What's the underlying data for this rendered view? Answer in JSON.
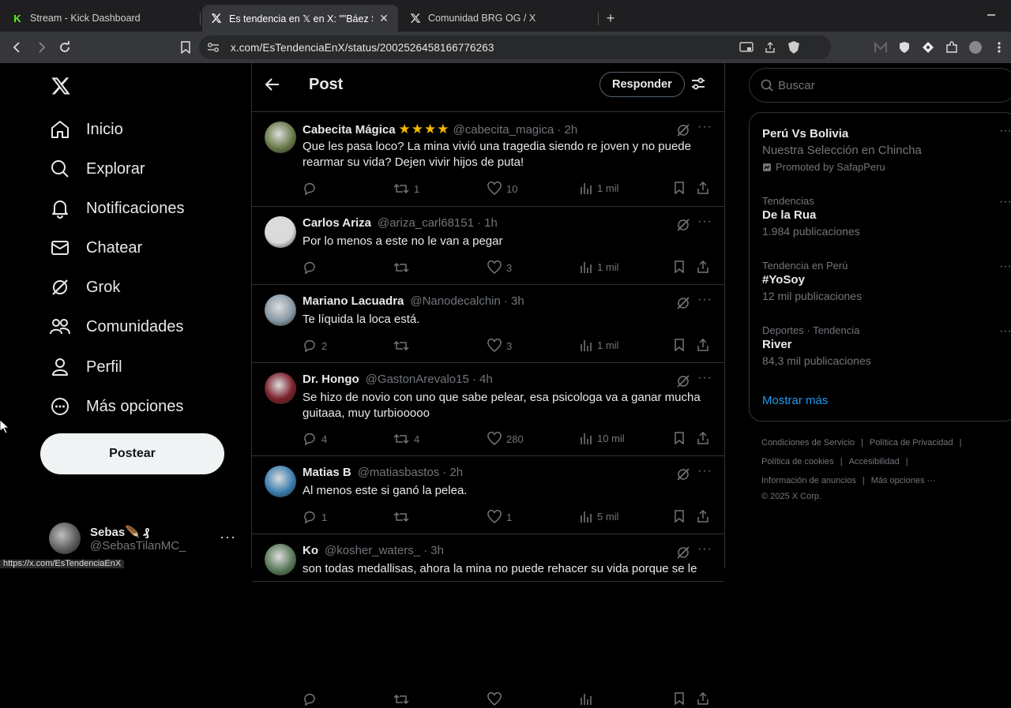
{
  "browser": {
    "tabs": [
      {
        "title": "Stream - Kick Dashboard",
        "favicon": "kick-icon",
        "active": false
      },
      {
        "title": "Es tendencia en 𝕏 en X: \"\"Báez Sosa",
        "favicon": "x-icon",
        "active": true
      },
      {
        "title": "Comunidad BRG OG / X",
        "favicon": "x-icon",
        "active": false
      }
    ],
    "url": "x.com/EsTendenciaEnX/status/2002526458166776263",
    "status_url": "https://x.com/EsTendenciaEnX"
  },
  "nav": {
    "items": [
      {
        "label": "Inicio",
        "icon": "home-icon"
      },
      {
        "label": "Explorar",
        "icon": "search-icon"
      },
      {
        "label": "Notificaciones",
        "icon": "bell-icon"
      },
      {
        "label": "Chatear",
        "icon": "mail-icon"
      },
      {
        "label": "Grok",
        "icon": "grok-icon"
      },
      {
        "label": "Comunidades",
        "icon": "communities-icon"
      },
      {
        "label": "Perfil",
        "icon": "person-icon"
      },
      {
        "label": "Más opciones",
        "icon": "more-circle-icon"
      }
    ],
    "post_button": "Postear",
    "account": {
      "name": "Sebas🪶 ₰",
      "handle": "@SebasTilanMC_"
    }
  },
  "main": {
    "title": "Post",
    "reply_button": "Responder",
    "posts": [
      {
        "name": "Cabecita Mágica",
        "stars": "★★★★",
        "handle": "@cabecita_magica",
        "time": "· 2h",
        "text": "Que les pasa loco? La mina vivió una tragedia siendo re joven y no puede rearmar su vida? Dejen vivir hijos de puta!",
        "replies": "",
        "reposts": "1",
        "likes": "10",
        "views": "1 mil",
        "avatar_color": "#6b7a4a"
      },
      {
        "name": "Carlos Ariza",
        "stars": "",
        "handle": "@ariza_carl68151",
        "time": "· 1h",
        "text": "Por lo menos a este no le van a pegar",
        "replies": "",
        "reposts": "",
        "likes": "3",
        "views": "1 mil",
        "avatar_color": "#d9d9d9"
      },
      {
        "name": "Mariano Lacuadra",
        "stars": "",
        "handle": "@Nanodecalchin",
        "time": "· 3h",
        "text": "Te líquida la loca está.",
        "replies": "2",
        "reposts": "",
        "likes": "3",
        "views": "1 mil",
        "avatar_color": "#8899a6"
      },
      {
        "name": "Dr. Hongo",
        "stars": "",
        "handle": "@GastonArevalo15",
        "time": "· 4h",
        "text": "Se hizo de novio con uno que sabe pelear, esa psicologa va a ganar mucha guitaaa, muy turbiooooo",
        "replies": "4",
        "reposts": "4",
        "likes": "280",
        "views": "10 mil",
        "avatar_color": "#7a1f2a"
      },
      {
        "name": "Matias B",
        "stars": "",
        "handle": "@matiasbastos",
        "time": "· 2h",
        "text": "Al menos este si ganó la pelea.",
        "replies": "1",
        "reposts": "",
        "likes": "1",
        "views": "5 mil",
        "avatar_color": "#3c7fb0"
      },
      {
        "name": "Ko",
        "stars": "",
        "handle": "@kosher_waters_",
        "time": "· 3h",
        "text": "son todas medallisas, ahora la mina no puede rehacer su vida porque se le",
        "replies": "",
        "reposts": "",
        "likes": "",
        "views": "",
        "avatar_color": "#5a7a5a"
      }
    ]
  },
  "sidebar": {
    "search_placeholder": "Buscar",
    "trends": [
      {
        "context": "",
        "name": "Perú Vs Bolivia",
        "subtitle": "Nuestra Selección en Chincha",
        "promoted": "Promoted by SafapPeru"
      },
      {
        "context": "Tendencias",
        "name": "De la Rua",
        "subtitle": "1.984 publicaciones",
        "promoted": ""
      },
      {
        "context": "Tendencia en Perú",
        "name": "#YoSoy",
        "subtitle": "12 mil publicaciones",
        "promoted": ""
      },
      {
        "context": "Deportes · Tendencia",
        "name": "River",
        "subtitle": "84,3 mil publicaciones",
        "promoted": ""
      }
    ],
    "show_more": "Mostrar más",
    "footer": {
      "line1": [
        "Condiciones de Servicio",
        "Política de Privacidad"
      ],
      "line2": [
        "Política de cookies",
        "Accesibilidad"
      ],
      "line3": [
        "Información de anuncios",
        "Más opciones ···"
      ],
      "copyright": "© 2025 X Corp."
    }
  }
}
